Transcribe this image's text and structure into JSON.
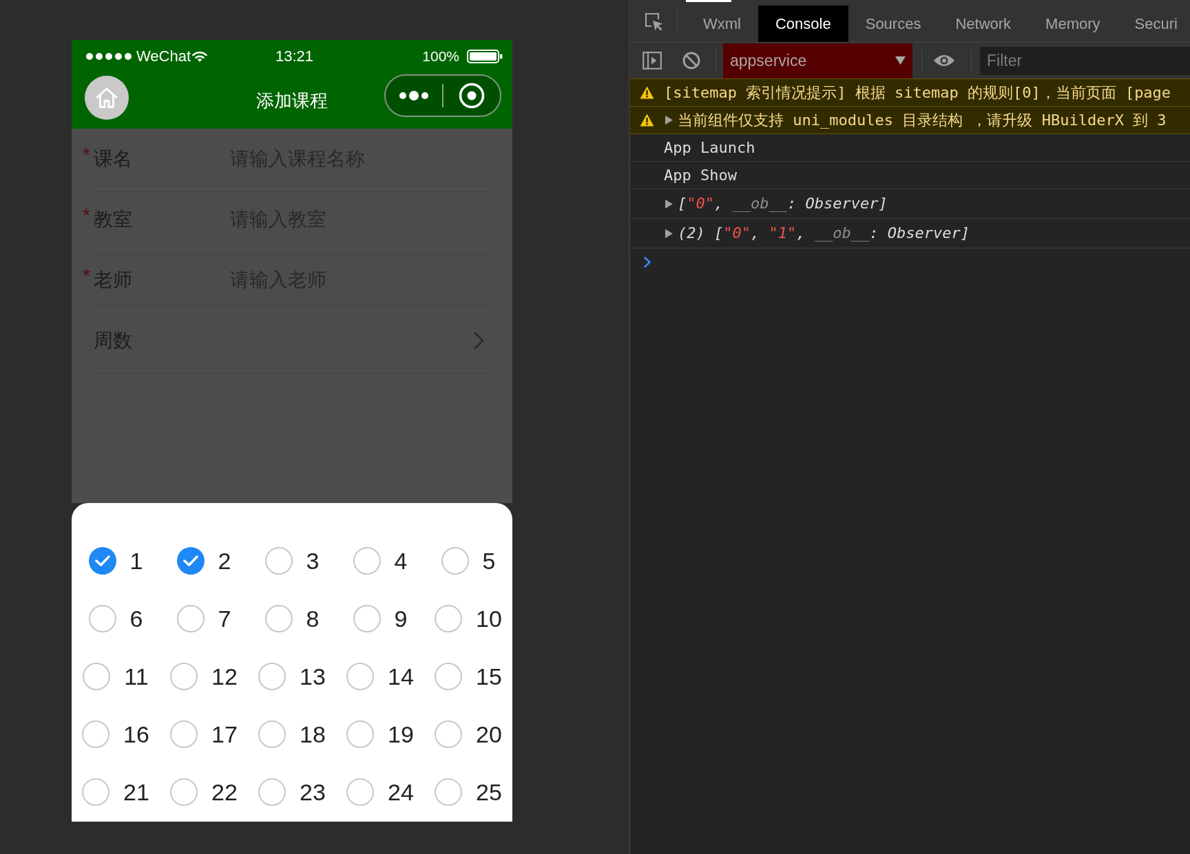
{
  "phone": {
    "status_bar": {
      "carrier": "WeChat",
      "time": "13:21",
      "battery": "100%"
    },
    "nav_bar": {
      "title": "添加课程"
    },
    "form": {
      "fields": [
        {
          "kind": "input",
          "required_mark": "*",
          "label": "课名",
          "placeholder": "请输入课程名称"
        },
        {
          "kind": "input",
          "required_mark": "*",
          "label": "教室",
          "placeholder": "请输入教室"
        },
        {
          "kind": "input",
          "required_mark": "*",
          "label": "老师",
          "placeholder": "请输入老师"
        },
        {
          "kind": "picker",
          "label": "周数"
        }
      ]
    },
    "week_picker": {
      "options": [
        {
          "label": "1",
          "checked": true
        },
        {
          "label": "2",
          "checked": true
        },
        {
          "label": "3",
          "checked": false
        },
        {
          "label": "4",
          "checked": false
        },
        {
          "label": "5",
          "checked": false
        },
        {
          "label": "6",
          "checked": false
        },
        {
          "label": "7",
          "checked": false
        },
        {
          "label": "8",
          "checked": false
        },
        {
          "label": "9",
          "checked": false
        },
        {
          "label": "10",
          "checked": false
        },
        {
          "label": "11",
          "checked": false
        },
        {
          "label": "12",
          "checked": false
        },
        {
          "label": "13",
          "checked": false
        },
        {
          "label": "14",
          "checked": false
        },
        {
          "label": "15",
          "checked": false
        },
        {
          "label": "16",
          "checked": false
        },
        {
          "label": "17",
          "checked": false
        },
        {
          "label": "18",
          "checked": false
        },
        {
          "label": "19",
          "checked": false
        },
        {
          "label": "20",
          "checked": false
        },
        {
          "label": "21",
          "checked": false
        },
        {
          "label": "22",
          "checked": false
        },
        {
          "label": "23",
          "checked": false
        },
        {
          "label": "24",
          "checked": false
        },
        {
          "label": "25",
          "checked": false
        }
      ]
    }
  },
  "devtools": {
    "tabs": [
      {
        "label": "Wxml",
        "selected": false
      },
      {
        "label": "Console",
        "selected": true
      },
      {
        "label": "Sources",
        "selected": false
      },
      {
        "label": "Network",
        "selected": false
      },
      {
        "label": "Memory",
        "selected": false
      },
      {
        "label": "Securi",
        "selected": false
      }
    ],
    "toolbar": {
      "context": "appservice",
      "filter": {
        "placeholder": "Filter"
      }
    },
    "console": {
      "messages": [
        {
          "kind": "warning",
          "text": "[sitemap 索引情况提示] 根据 sitemap 的规则[0]，当前页面 [page"
        },
        {
          "kind": "warning",
          "expanded": false,
          "text": "当前组件仅支持 uni_modules 目录结构 ，请升级 HBuilderX 到 3"
        },
        {
          "kind": "log",
          "text": "App Launch"
        },
        {
          "kind": "log",
          "text": "App Show"
        },
        {
          "kind": "object",
          "expanded": false,
          "parts": [
            {
              "kind": "plain",
              "text": "["
            },
            {
              "kind": "string",
              "text": "\"0\""
            },
            {
              "kind": "plain",
              "text": ", "
            },
            {
              "kind": "key",
              "text": "__ob__"
            },
            {
              "kind": "plain",
              "text": ": Observer]"
            }
          ]
        },
        {
          "kind": "object",
          "expanded": false,
          "parts": [
            {
              "kind": "plain",
              "text": "(2) ["
            },
            {
              "kind": "string",
              "text": "\"0\""
            },
            {
              "kind": "plain",
              "text": ", "
            },
            {
              "kind": "string",
              "text": "\"1\""
            },
            {
              "kind": "plain",
              "text": ", "
            },
            {
              "kind": "key",
              "text": "__ob__"
            },
            {
              "kind": "plain",
              "text": ": Observer]"
            }
          ]
        }
      ]
    }
  }
}
